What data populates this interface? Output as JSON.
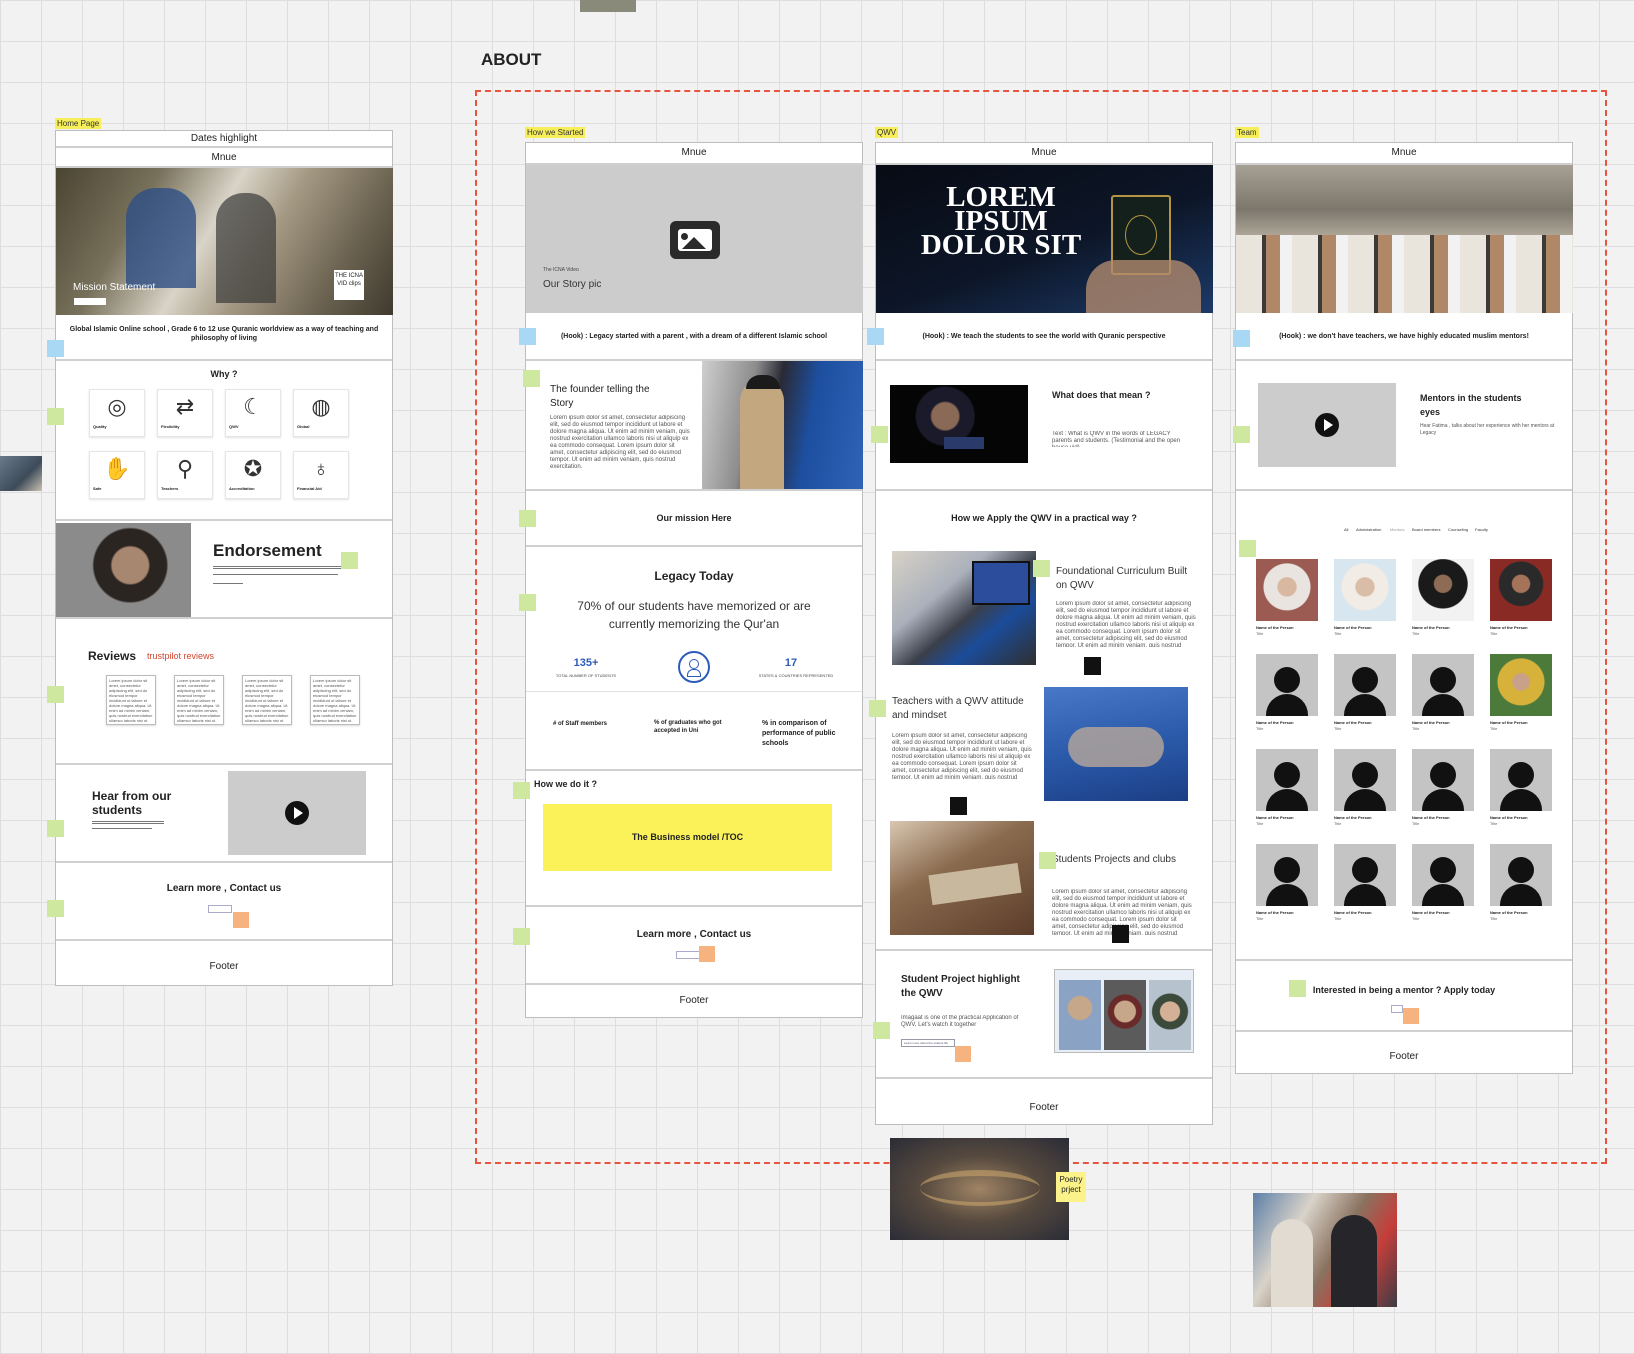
{
  "board_title": "ABOUT",
  "colors": {
    "sticky_green": "#cfe8a0",
    "sticky_blue": "#a9d8f5",
    "sticky_orange": "#f6b37f",
    "tag_yellow": "#f7ef5a",
    "dashed_border": "#e8553f",
    "business_yellow": "#fbf25a",
    "legacy_blue": "#2d5bb9"
  },
  "home": {
    "tag": "Home Page",
    "dates_highlight": "Dates highlight",
    "menu": "Mnue",
    "hero_caption": "Mission Statement",
    "hero_clip": "THE ICNA VID clips",
    "mission": "Global Islamic Online school , Grade 6 to 12 use Quranic worldview as a way of teaching and philosophy of living",
    "why_title": "Why ?",
    "features": [
      {
        "label": "Quality",
        "icon": "quality-badge-icon"
      },
      {
        "label": "Flexibility",
        "icon": "arrows-icon"
      },
      {
        "label": "QWV",
        "icon": "hand-moon-icon"
      },
      {
        "label": "Global",
        "icon": "globe-icon"
      },
      {
        "label": "Safe",
        "icon": "safe-hands-icon"
      },
      {
        "label": "Teachers",
        "icon": "teacher-icon"
      },
      {
        "label": "Accreditation",
        "icon": "award-icon"
      },
      {
        "label": "Financial Aid",
        "icon": "lightbulb-icon"
      }
    ],
    "endorsement": "Endorsement",
    "reviews_title": "Reviews",
    "reviews_link": "trustpilot reviews",
    "hear_from": "Hear from our students",
    "learn_more": "Learn more , Contact us",
    "footer": "Footer"
  },
  "story": {
    "tag": "How we Started",
    "menu": "Mnue",
    "icna_video": "The ICNA  Video",
    "story_pic": "Our Story pic",
    "hook": "(Hook) : Legacy started with a parent , with a dream of a different Islamic school",
    "founder_title": "The founder telling the Story",
    "mission": "Our mission Here",
    "legacy_title": "Legacy Today",
    "legacy_stat": "70% of our students have memorized or are currently memorizing the Qur'an",
    "stat1_value": "135+",
    "stat1_label": "TOTAL NUMBER OF STUDENTS",
    "stat2_value": "17",
    "stat2_label": "STATES & COUNTRIES REPRESENTED",
    "staff": "# of Staff members",
    "graduates": "% of graduates who got accepted in Uni",
    "comparison": "% in comparison of performance of public schools",
    "how_title": "How we do it ?",
    "business": "The Business model /TOC",
    "learn_more": "Learn more , Contact us",
    "footer": "Footer"
  },
  "qwv": {
    "tag": "QWV",
    "menu": "Mnue",
    "hero_text": "LOREM IPSUM DOLOR SIT",
    "hook": "(Hook) : We teach the students to see the world with Quranic perspective",
    "what_title": "What does that mean ?",
    "what_text": "Text : What is QWV in the words of LEGACY parents and students. (Testimonial and the open house vid)",
    "apply_title": "How we Apply the QWV in a practical way ?",
    "foundational": "Foundational Curriculum Built on QWV",
    "teachers": "Teachers with a QWV attitude and mindset",
    "projects": "Students Projects and clubs",
    "project_title": "Student Project highlight the QWV",
    "project_text": "Imagaat is one of the practical Application of QWV, Let's watch it together",
    "project_btn": "Learn more about the student life",
    "footer": "Footer"
  },
  "team": {
    "tag": "Team",
    "menu": "Mnue",
    "hook": "(Hook) : we don't have teachers, we have highly educated muslim mentors!",
    "mentors_title": "Mentors in the students eyes",
    "mentors_text": "Hear Fatima , talks about her experience with her mentors at Legacy",
    "filters": [
      "All",
      "Administration",
      "Mentors",
      "Board members",
      "Counseling",
      "Faculty"
    ],
    "person_name": "Name of the Person",
    "person_title": "Title",
    "apply": "Interested in being a mentor ? Apply today",
    "footer": "Footer"
  },
  "poetry_note": "Poetry prject",
  "lorem": "Lorem ipsum dolor sit amet, consectetur adipiscing elit, sed do eiusmod tempor incididunt ut labore et dolore magna aliqua. Ut enim ad minim veniam, quis nostrud exercitation ullamco laboris nisi ut aliquip ex ea commodo consequat. Lorem ipsum dolor sit amet, consectetur adipiscing elit, sed do eiusmod tempor. Ut enim ad minim veniam, quis nostrud exercitation."
}
